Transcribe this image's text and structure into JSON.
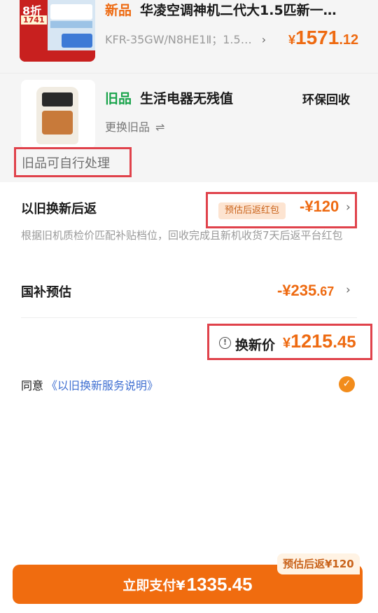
{
  "new_item": {
    "tag": "新品",
    "name": "华凌空调神机二代大1.5匹新一…",
    "spec": "KFR-35GW/N8HE1Ⅱ；1.5…",
    "spec_chevron": "›",
    "price_symbol": "¥",
    "price_int": "1571",
    "price_dec": ".12",
    "thumb_discount": "8折",
    "thumb_price": "1741"
  },
  "old_item": {
    "tag": "旧品",
    "name": "生活电器无残值",
    "service": "环保回收",
    "swap_label": "更换旧品",
    "swap_icon": "⇌",
    "self_dispose": "旧品可自行处理"
  },
  "trade_in": {
    "title": "以旧换新后返",
    "badge": "预估后返红包",
    "amount": "-¥120",
    "description": "根据旧机质检价匹配补贴档位，回收完成且新机收货7天后返平台红包"
  },
  "subsidy": {
    "title": "国补预估",
    "amount_int": "-¥235",
    "amount_dec": ".67"
  },
  "final": {
    "info_icon": "!",
    "label": "换新价",
    "price_symbol": "¥",
    "price_int": "1215",
    "price_dec": ".45"
  },
  "agreement": {
    "prefix": "同意",
    "link": "《以旧换新服务说明》",
    "checked_icon": "✓"
  },
  "pay": {
    "label": "立即支付¥",
    "amount": "1335.45",
    "badge": "预估后返¥120"
  },
  "colors": {
    "accent": "#f06c0f",
    "new_tag": "#ee6a11",
    "old_tag": "#18a34a",
    "highlight_border": "#e0424b",
    "link": "#3f6fd1"
  }
}
